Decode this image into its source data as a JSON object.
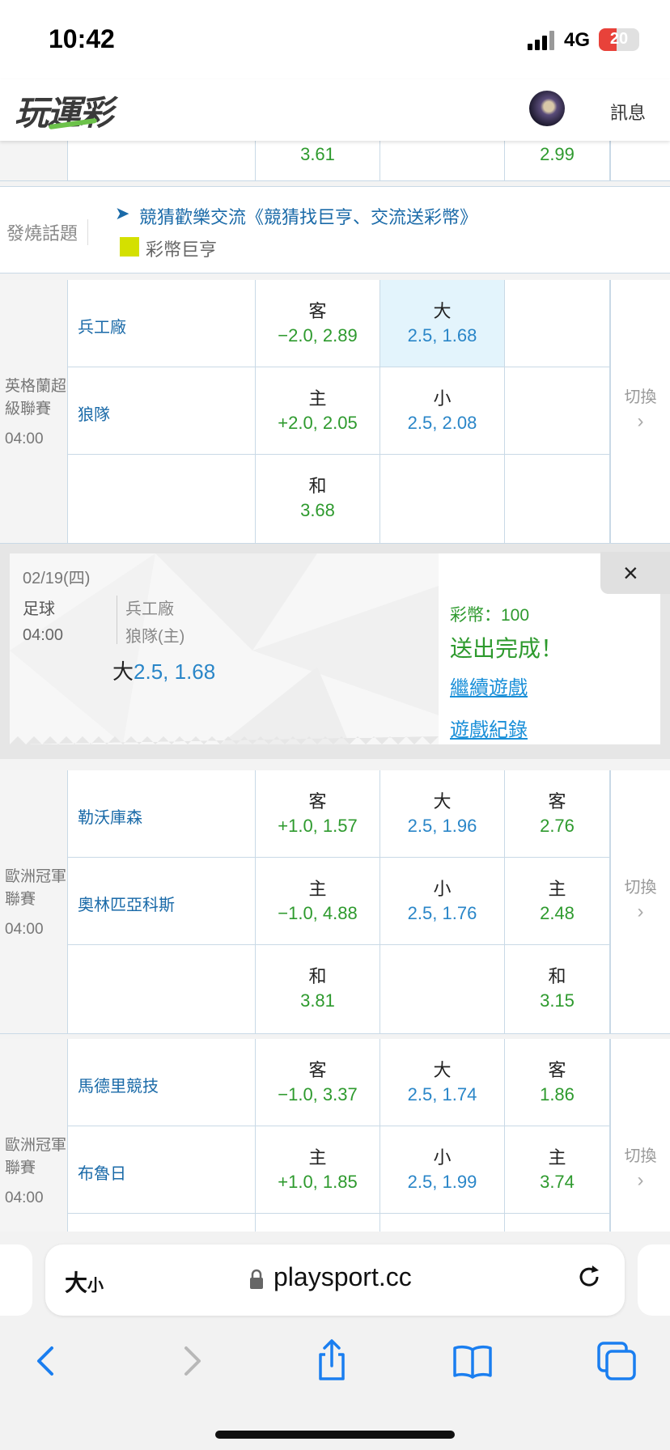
{
  "status": {
    "time": "10:42",
    "network": "4G",
    "battery": "20"
  },
  "header": {
    "logo": "玩運彩",
    "messages": "訊息"
  },
  "top_partial": {
    "odd1": "3.61",
    "odd3": "2.99"
  },
  "hot_topic": {
    "label": "發燒話題",
    "link": "競猜歡樂交流《競猜找巨亨、交流送彩幣》",
    "sub": "彩幣巨亨"
  },
  "match1": {
    "league": "英格蘭超級聯賽",
    "time": "04:00",
    "away": "兵工廠",
    "home": "狼隊",
    "away_spread_label": "客",
    "away_spread": "−2.0, 2.89",
    "over_label": "大",
    "over": "2.5, 1.68",
    "home_spread_label": "主",
    "home_spread": "+2.0, 2.05",
    "under_label": "小",
    "under": "2.5, 2.08",
    "draw_label": "和",
    "draw": "3.68",
    "switch": "切換",
    "chevron": "›"
  },
  "popup": {
    "date": "02/19(四)",
    "sport": "足球",
    "time": "04:00",
    "away": "兵工廠",
    "home": "狼隊(主)",
    "bet_label": "大",
    "bet_value": "2.5, 1.68",
    "coins": "彩幣：100",
    "done": "送出完成！",
    "continue": "繼續遊戲",
    "history": "遊戲紀錄",
    "close": "×"
  },
  "match2": {
    "league": "歐洲冠軍聯賽",
    "time": "04:00",
    "away": "勒沃庫森",
    "home": "奧林匹亞科斯",
    "away_spread_label": "客",
    "away_spread": "+1.0, 1.57",
    "over_label": "大",
    "over": "2.5, 1.96",
    "away_ml_label": "客",
    "away_ml": "2.76",
    "home_spread_label": "主",
    "home_spread": "−1.0, 4.88",
    "under_label": "小",
    "under": "2.5, 1.76",
    "home_ml_label": "主",
    "home_ml": "2.48",
    "draw_label": "和",
    "draw": "3.81",
    "draw2_label": "和",
    "draw2": "3.15",
    "switch": "切換",
    "chevron": "›"
  },
  "match3": {
    "league": "歐洲冠軍聯賽",
    "time": "04:00",
    "away": "馬德里競技",
    "home": "布魯日",
    "away_spread_label": "客",
    "away_spread": "−1.0, 3.37",
    "over_label": "大",
    "over": "2.5, 1.74",
    "away_ml_label": "客",
    "away_ml": "1.86",
    "home_spread_label": "主",
    "home_spread": "+1.0, 1.85",
    "under_label": "小",
    "under": "2.5, 1.99",
    "home_ml_label": "主",
    "home_ml": "3.74",
    "switch": "切換",
    "chevron": "›"
  },
  "safari": {
    "text_size": "大",
    "text_size_small": "小",
    "url": "playsport.cc"
  }
}
